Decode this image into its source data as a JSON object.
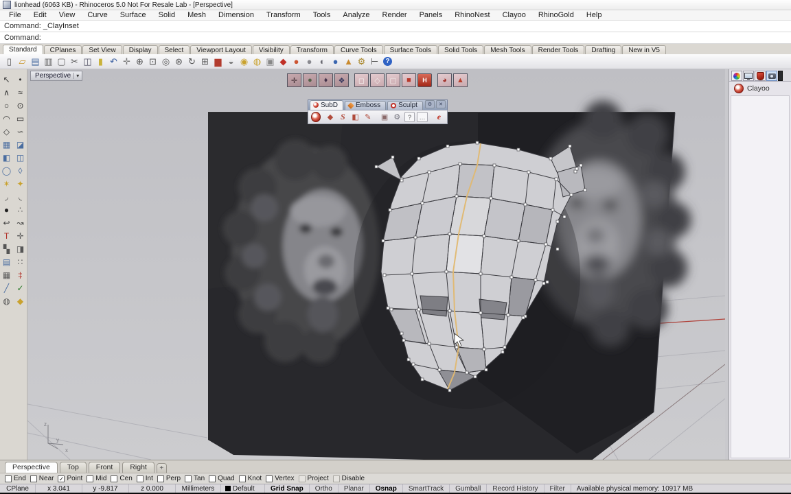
{
  "window": {
    "title": "lionhead (6063 KB) - Rhinoceros 5.0 Not For Resale Lab - [Perspective]"
  },
  "menu": {
    "items": [
      {
        "name": "menu-file",
        "label": "File"
      },
      {
        "name": "menu-edit",
        "label": "Edit"
      },
      {
        "name": "menu-view",
        "label": "View"
      },
      {
        "name": "menu-curve",
        "label": "Curve"
      },
      {
        "name": "menu-surface",
        "label": "Surface"
      },
      {
        "name": "menu-solid",
        "label": "Solid"
      },
      {
        "name": "menu-mesh",
        "label": "Mesh"
      },
      {
        "name": "menu-dimension",
        "label": "Dimension"
      },
      {
        "name": "menu-transform",
        "label": "Transform"
      },
      {
        "name": "menu-tools",
        "label": "Tools"
      },
      {
        "name": "menu-analyze",
        "label": "Analyze"
      },
      {
        "name": "menu-render",
        "label": "Render"
      },
      {
        "name": "menu-panels",
        "label": "Panels"
      },
      {
        "name": "menu-rhinonest",
        "label": "RhinoNest"
      },
      {
        "name": "menu-clayoo",
        "label": "Clayoo"
      },
      {
        "name": "menu-rhinogold",
        "label": "RhinoGold"
      },
      {
        "name": "menu-help",
        "label": "Help"
      }
    ]
  },
  "command": {
    "history_line": "Command: _ClayInset",
    "prompt_line": "Command:"
  },
  "ribbon": {
    "tabs": [
      {
        "name": "ribbon-tab-standard",
        "label": "Standard",
        "cls": "active"
      },
      {
        "name": "ribbon-tab-cplanes",
        "label": "CPlanes"
      },
      {
        "name": "ribbon-tab-set-view",
        "label": "Set View"
      },
      {
        "name": "ribbon-tab-display",
        "label": "Display"
      },
      {
        "name": "ribbon-tab-select",
        "label": "Select"
      },
      {
        "name": "ribbon-tab-viewport-layout",
        "label": "Viewport Layout"
      },
      {
        "name": "ribbon-tab-visibility",
        "label": "Visibility"
      },
      {
        "name": "ribbon-tab-transform",
        "label": "Transform"
      },
      {
        "name": "ribbon-tab-curve-tools",
        "label": "Curve Tools"
      },
      {
        "name": "ribbon-tab-surface-tools",
        "label": "Surface Tools"
      },
      {
        "name": "ribbon-tab-solid-tools",
        "label": "Solid Tools"
      },
      {
        "name": "ribbon-tab-mesh-tools",
        "label": "Mesh Tools"
      },
      {
        "name": "ribbon-tab-render-tools",
        "label": "Render Tools"
      },
      {
        "name": "ribbon-tab-drafting",
        "label": "Drafting"
      },
      {
        "name": "ribbon-tab-new-in-v5",
        "label": "New in V5"
      }
    ]
  },
  "main_toolbar": [
    {
      "name": "new-file-icon",
      "glyph": "▯",
      "color": "#555"
    },
    {
      "name": "open-file-icon",
      "glyph": "▱",
      "color": "#c9972e"
    },
    {
      "name": "save-icon",
      "glyph": "▤",
      "color": "#4a6da0"
    },
    {
      "name": "print-icon",
      "glyph": "▥",
      "color": "#666"
    },
    {
      "name": "export-icon",
      "glyph": "▢",
      "color": "#666"
    },
    {
      "name": "cut-icon",
      "glyph": "✂",
      "color": "#555"
    },
    {
      "name": "copy-icon",
      "glyph": "◫",
      "color": "#556"
    },
    {
      "name": "paste-icon",
      "glyph": "▮",
      "color": "#c9b23a"
    },
    {
      "name": "undo-icon",
      "glyph": "↶",
      "color": "#3a5fa0"
    },
    {
      "name": "pan-icon",
      "glyph": "✛",
      "color": "#777"
    },
    {
      "name": "zoom-dynamic-icon",
      "glyph": "⊕",
      "color": "#555"
    },
    {
      "name": "zoom-window-icon",
      "glyph": "⊡",
      "color": "#555"
    },
    {
      "name": "zoom-selected-icon",
      "glyph": "◎",
      "color": "#555"
    },
    {
      "name": "zoom-extents-icon",
      "glyph": "⊛",
      "color": "#555"
    },
    {
      "name": "rotate-view-icon",
      "glyph": "↻",
      "color": "#555"
    },
    {
      "name": "viewport-layout-icon",
      "glyph": "⊞",
      "color": "#555"
    },
    {
      "name": "shade-icon",
      "glyph": "▆",
      "color": "#b23b2e"
    },
    {
      "name": "render-preview-icon",
      "glyph": "◒",
      "color": "#777"
    },
    {
      "name": "sun-icon",
      "glyph": "◉",
      "color": "#c9a22e"
    },
    {
      "name": "lamp-icon",
      "glyph": "◍",
      "color": "#c9a22e"
    },
    {
      "name": "lock-icon",
      "glyph": "▣",
      "color": "#888"
    },
    {
      "name": "render-icon",
      "glyph": "◆",
      "color": "#c03028"
    },
    {
      "name": "color-wheel-icon",
      "glyph": "●",
      "color": "#cc5533"
    },
    {
      "name": "shaded-mode-icon",
      "glyph": "●",
      "color": "#8a8a90"
    },
    {
      "name": "ghosted-mode-icon",
      "glyph": "◐",
      "color": "#6a6a72"
    },
    {
      "name": "rendered-mode-icon",
      "glyph": "●",
      "color": "#3a66b0"
    },
    {
      "name": "cone-icon",
      "glyph": "▲",
      "color": "#c98a2e"
    },
    {
      "name": "gears-icon",
      "glyph": "⚙",
      "color": "#a8862a"
    },
    {
      "name": "dimension-icon",
      "glyph": "⊢",
      "color": "#555"
    },
    {
      "name": "help-icon",
      "glyph": "?",
      "color": "#fff",
      "cls": "round-blue"
    }
  ],
  "side_toolbar": [
    {
      "name": "tool-select-icon",
      "glyph": "↖",
      "color": "#333"
    },
    {
      "name": "tool-point-icon",
      "glyph": "•",
      "color": "#333"
    },
    {
      "name": "tool-polyline-icon",
      "glyph": "∧",
      "color": "#333"
    },
    {
      "name": "tool-curve-icon",
      "glyph": "≈",
      "color": "#333"
    },
    {
      "name": "tool-circle-icon",
      "glyph": "○",
      "color": "#333"
    },
    {
      "name": "tool-ellipse-icon",
      "glyph": "⊙",
      "color": "#333"
    },
    {
      "name": "tool-arc-icon",
      "glyph": "◠",
      "color": "#333"
    },
    {
      "name": "tool-rectangle-icon",
      "glyph": "▭",
      "color": "#333"
    },
    {
      "name": "tool-polygon-icon",
      "glyph": "◇",
      "color": "#333"
    },
    {
      "name": "tool-freeform-icon",
      "glyph": "∽",
      "color": "#333"
    },
    {
      "name": "tool-surface-icon",
      "glyph": "▦",
      "color": "#4a6da0"
    },
    {
      "name": "tool-loft-icon",
      "glyph": "◪",
      "color": "#4a6da0"
    },
    {
      "name": "tool-box-icon",
      "glyph": "◧",
      "color": "#4a6da0"
    },
    {
      "name": "tool-cylinder-icon",
      "glyph": "◫",
      "color": "#4a6da0"
    },
    {
      "name": "tool-torus-icon",
      "glyph": "◯",
      "color": "#4a6da0"
    },
    {
      "name": "tool-deform-icon",
      "glyph": "◊",
      "color": "#4a6da0"
    },
    {
      "name": "tool-explode-icon",
      "glyph": "✶",
      "color": "#c9a22e"
    },
    {
      "name": "tool-blast-icon",
      "glyph": "✦",
      "color": "#c9a22e"
    },
    {
      "name": "tool-fillet-icon",
      "glyph": "◞",
      "color": "#444"
    },
    {
      "name": "tool-chamfer-icon",
      "glyph": "◟",
      "color": "#444"
    },
    {
      "name": "tool-boolean-icon",
      "glyph": "●",
      "color": "#222"
    },
    {
      "name": "tool-array-points-icon",
      "glyph": "∴",
      "color": "#555"
    },
    {
      "name": "tool-hook-icon",
      "glyph": "↩",
      "color": "#444"
    },
    {
      "name": "tool-curve-edit-icon",
      "glyph": "↝",
      "color": "#444"
    },
    {
      "name": "tool-text-icon",
      "glyph": "T",
      "color": "#b03028"
    },
    {
      "name": "tool-move-icon",
      "glyph": "✛",
      "color": "#555"
    },
    {
      "name": "tool-blocks-icon",
      "glyph": "▚",
      "color": "#555"
    },
    {
      "name": "tool-mirror-icon",
      "glyph": "◨",
      "color": "#555"
    },
    {
      "name": "tool-surface-tools-icon",
      "glyph": "▤",
      "color": "#4a6da0"
    },
    {
      "name": "tool-array-icon",
      "glyph": "∷",
      "color": "#555"
    },
    {
      "name": "tool-grid-icon",
      "glyph": "▦",
      "color": "#555"
    },
    {
      "name": "tool-dimension-icon",
      "glyph": "‡",
      "color": "#b03028"
    },
    {
      "name": "tool-trim-icon",
      "glyph": "╱",
      "color": "#4a6da0"
    },
    {
      "name": "tool-check-icon",
      "glyph": "✓",
      "color": "#2a7a2a"
    },
    {
      "name": "tool-spheres-icon",
      "glyph": "◍",
      "color": "#555"
    },
    {
      "name": "tool-diamond-icon",
      "glyph": "◆",
      "color": "#c9a22e"
    }
  ],
  "viewport": {
    "label": "Perspective",
    "dropdown_glyph": "▾"
  },
  "clayoo_toolbar": [
    {
      "name": "clayoo-subd-pin-icon",
      "glyph": "✛",
      "color": "#3f2d33"
    },
    {
      "name": "clayoo-subd-sphere-icon",
      "glyph": "●",
      "color": "#54624a"
    },
    {
      "name": "clayoo-subd-pipe-icon",
      "glyph": "♦",
      "color": "#43324a"
    },
    {
      "name": "clayoo-subd-cluster-icon",
      "glyph": "❖",
      "color": "#3a3a5e"
    },
    {
      "name": "clayoo-box-icon",
      "glyph": "◻",
      "color": "#f6f2f0",
      "cls": "light gap"
    },
    {
      "name": "clayoo-open-box-icon",
      "glyph": "◇",
      "color": "#f0e8e6",
      "cls": "light"
    },
    {
      "name": "clayoo-round-box-icon",
      "glyph": "▢",
      "color": "#efe6e4",
      "cls": "light"
    },
    {
      "name": "clayoo-red-box-icon",
      "glyph": "■",
      "color": "#b83a2c",
      "cls": "light"
    },
    {
      "name": "clayoo-h-button-icon",
      "glyph": "H",
      "color": "#ffffff",
      "cls": "light hbtn"
    },
    {
      "name": "clayoo-sphere-sections-icon",
      "glyph": "◕",
      "color": "#a03028",
      "cls": "light gap"
    },
    {
      "name": "clayoo-cone-icon",
      "glyph": "▲",
      "color": "#b8402c",
      "cls": "light"
    }
  ],
  "clayoo_palette": {
    "tabs": [
      {
        "name": "tab-subd",
        "label": "SubD",
        "cls": "active",
        "icon": "red-dot"
      },
      {
        "name": "tab-emboss",
        "label": "Emboss",
        "icon": "orange-diamond"
      },
      {
        "name": "tab-sculpt",
        "label": "Sculpt",
        "icon": "red-ring"
      }
    ],
    "gear_glyph": "⚙",
    "close_glyph": "✕",
    "tools": [
      {
        "name": "clayoo-logo-icon",
        "glyph": "",
        "cls": "logo"
      },
      {
        "name": "subd-edit-icon",
        "glyph": "◆",
        "color": "#b04a3a"
      },
      {
        "name": "subd-sculpt-icon",
        "glyph": "S",
        "color": "#b04a3a",
        "cls": "ital"
      },
      {
        "name": "subd-box-icon",
        "glyph": "◧",
        "color": "#b04a3a"
      },
      {
        "name": "subd-pen-icon",
        "glyph": "✎",
        "color": "#b04a3a"
      },
      {
        "name": "subd-capture-icon",
        "glyph": "▣",
        "color": "#8a6a6a",
        "cls": "gap"
      },
      {
        "name": "subd-options-icon",
        "glyph": "⚙",
        "color": "#777780"
      },
      {
        "name": "subd-help-icon",
        "glyph": "?",
        "color": "#555",
        "cls": "boxed"
      },
      {
        "name": "subd-more-icon",
        "glyph": "…",
        "color": "#555",
        "cls": "boxed"
      },
      {
        "name": "subd-script-icon",
        "glyph": "e",
        "color": "#c03020",
        "cls": "ital gap"
      }
    ]
  },
  "right_panel": {
    "title": "Clayoo"
  },
  "viewport_tabs": {
    "tabs": [
      {
        "name": "vtab-perspective",
        "label": "Perspective",
        "cls": "active"
      },
      {
        "name": "vtab-top",
        "label": "Top"
      },
      {
        "name": "vtab-front",
        "label": "Front"
      },
      {
        "name": "vtab-right",
        "label": "Right"
      }
    ],
    "add_glyph": "+"
  },
  "osnap": {
    "items": [
      {
        "name": "osnap-end-checkbox",
        "label": "End",
        "check": ""
      },
      {
        "name": "osnap-near-checkbox",
        "label": "Near",
        "check": ""
      },
      {
        "name": "osnap-point-checkbox",
        "label": "Point",
        "check": "✓"
      },
      {
        "name": "osnap-mid-checkbox",
        "label": "Mid",
        "check": ""
      },
      {
        "name": "osnap-cen-checkbox",
        "label": "Cen",
        "check": ""
      },
      {
        "name": "osnap-int-checkbox",
        "label": "Int",
        "check": ""
      },
      {
        "name": "osnap-perp-checkbox",
        "label": "Perp",
        "check": ""
      },
      {
        "name": "osnap-tan-checkbox",
        "label": "Tan",
        "check": ""
      },
      {
        "name": "osnap-quad-checkbox",
        "label": "Quad",
        "check": ""
      },
      {
        "name": "osnap-knot-checkbox",
        "label": "Knot",
        "check": ""
      },
      {
        "name": "osnap-vertex-checkbox",
        "label": "Vertex",
        "check": ""
      },
      {
        "name": "osnap-project-checkbox",
        "label": "Project",
        "check": "",
        "cls": "flat"
      },
      {
        "name": "osnap-disable-checkbox",
        "label": "Disable",
        "check": "",
        "cls": "flat"
      }
    ]
  },
  "statusbar": {
    "cplane": "CPlane",
    "x": "x 3.041",
    "y": "y -9.817",
    "z": "z 0.000",
    "units": "Millimeters",
    "layer": "Default",
    "panes": [
      {
        "name": "pane-grid-snap",
        "label": "Grid Snap",
        "cls": "on"
      },
      {
        "name": "pane-ortho",
        "label": "Ortho"
      },
      {
        "name": "pane-planar",
        "label": "Planar"
      },
      {
        "name": "pane-osnap",
        "label": "Osnap",
        "cls": "on"
      },
      {
        "name": "pane-smarttrack",
        "label": "SmartTrack"
      },
      {
        "name": "pane-gumball",
        "label": "Gumball"
      },
      {
        "name": "pane-record-history",
        "label": "Record History"
      },
      {
        "name": "pane-filter",
        "label": "Filter"
      }
    ],
    "memory": "Available physical memory: 10917 MB"
  }
}
